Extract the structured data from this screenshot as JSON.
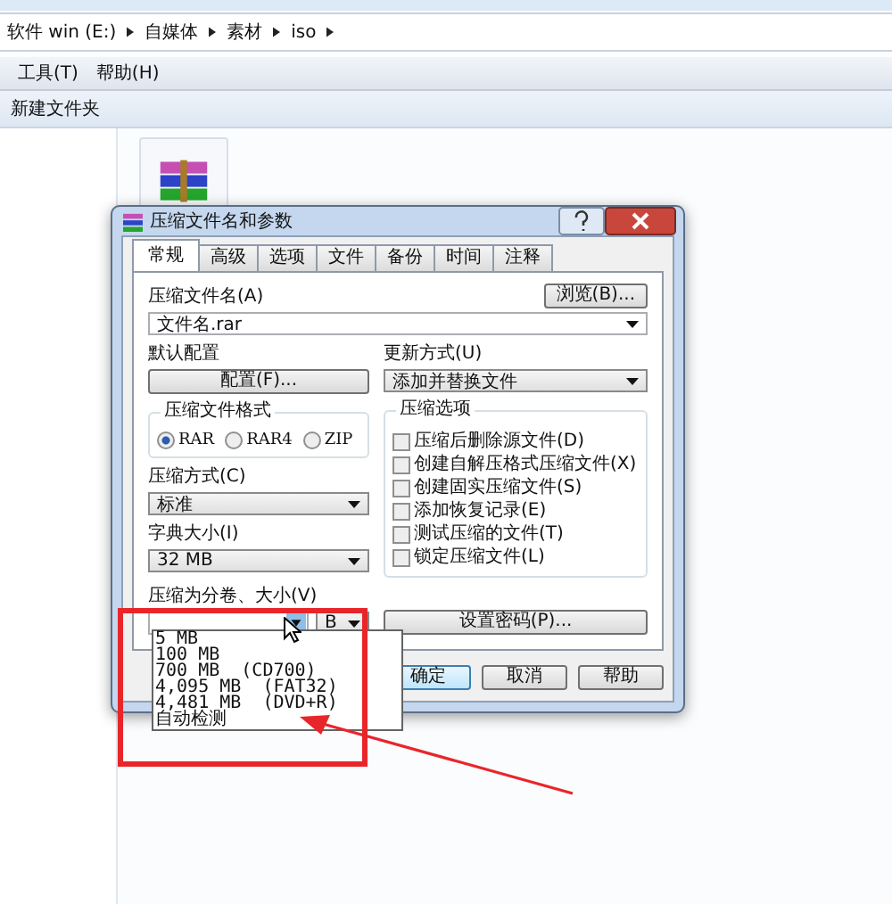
{
  "explorer": {
    "breadcrumb": [
      "软件 win (E:)",
      "自媒体",
      "素材",
      "iso"
    ],
    "menu": [
      "工具(T)",
      "帮助(H)"
    ],
    "toolbar": [
      "新建文件夹"
    ]
  },
  "dialog": {
    "title": "压缩文件名和参数",
    "tabs": [
      {
        "label": "常规",
        "selected": true
      },
      {
        "label": "高级",
        "selected": false
      },
      {
        "label": "选项",
        "selected": false
      },
      {
        "label": "文件",
        "selected": false
      },
      {
        "label": "备份",
        "selected": false
      },
      {
        "label": "时间",
        "selected": false
      },
      {
        "label": "注释",
        "selected": false
      }
    ],
    "archive_name_label": "压缩文件名(A)",
    "browse_button": "浏览(B)...",
    "archive_name": "文件名.rar",
    "profile_label": "默认配置",
    "profile_button": "配置(F)...",
    "update_label": "更新方式(U)",
    "update_mode": "添加并替换文件",
    "format": {
      "label": "压缩文件格式",
      "options": [
        {
          "label": "RAR",
          "selected": true
        },
        {
          "label": "RAR4",
          "selected": false
        },
        {
          "label": "ZIP",
          "selected": false
        }
      ]
    },
    "method_label": "压缩方式(C)",
    "method": "标准",
    "dict_label": "字典大小(I)",
    "dict": "32 MB",
    "split_label": "压缩为分卷、大小(V)",
    "split_unit": "B",
    "options": {
      "label": "压缩选项",
      "items": [
        {
          "label": "压缩后删除源文件(D)",
          "checked": false
        },
        {
          "label": "创建自解压格式压缩文件(X)",
          "checked": false
        },
        {
          "label": "创建固实压缩文件(S)",
          "checked": false
        },
        {
          "label": "添加恢复记录(E)",
          "checked": false
        },
        {
          "label": "测试压缩的文件(T)",
          "checked": false
        },
        {
          "label": "锁定压缩文件(L)",
          "checked": false
        }
      ]
    },
    "password_button": "设置密码(P)...",
    "buttons": [
      "确定",
      "取消",
      "帮助"
    ],
    "split_dropdown": [
      "5 MB",
      "100 MB",
      "700 MB  (CD700)",
      "4,095 MB  (FAT32)",
      "4,481 MB  (DVD+R)",
      "自动检测"
    ]
  }
}
